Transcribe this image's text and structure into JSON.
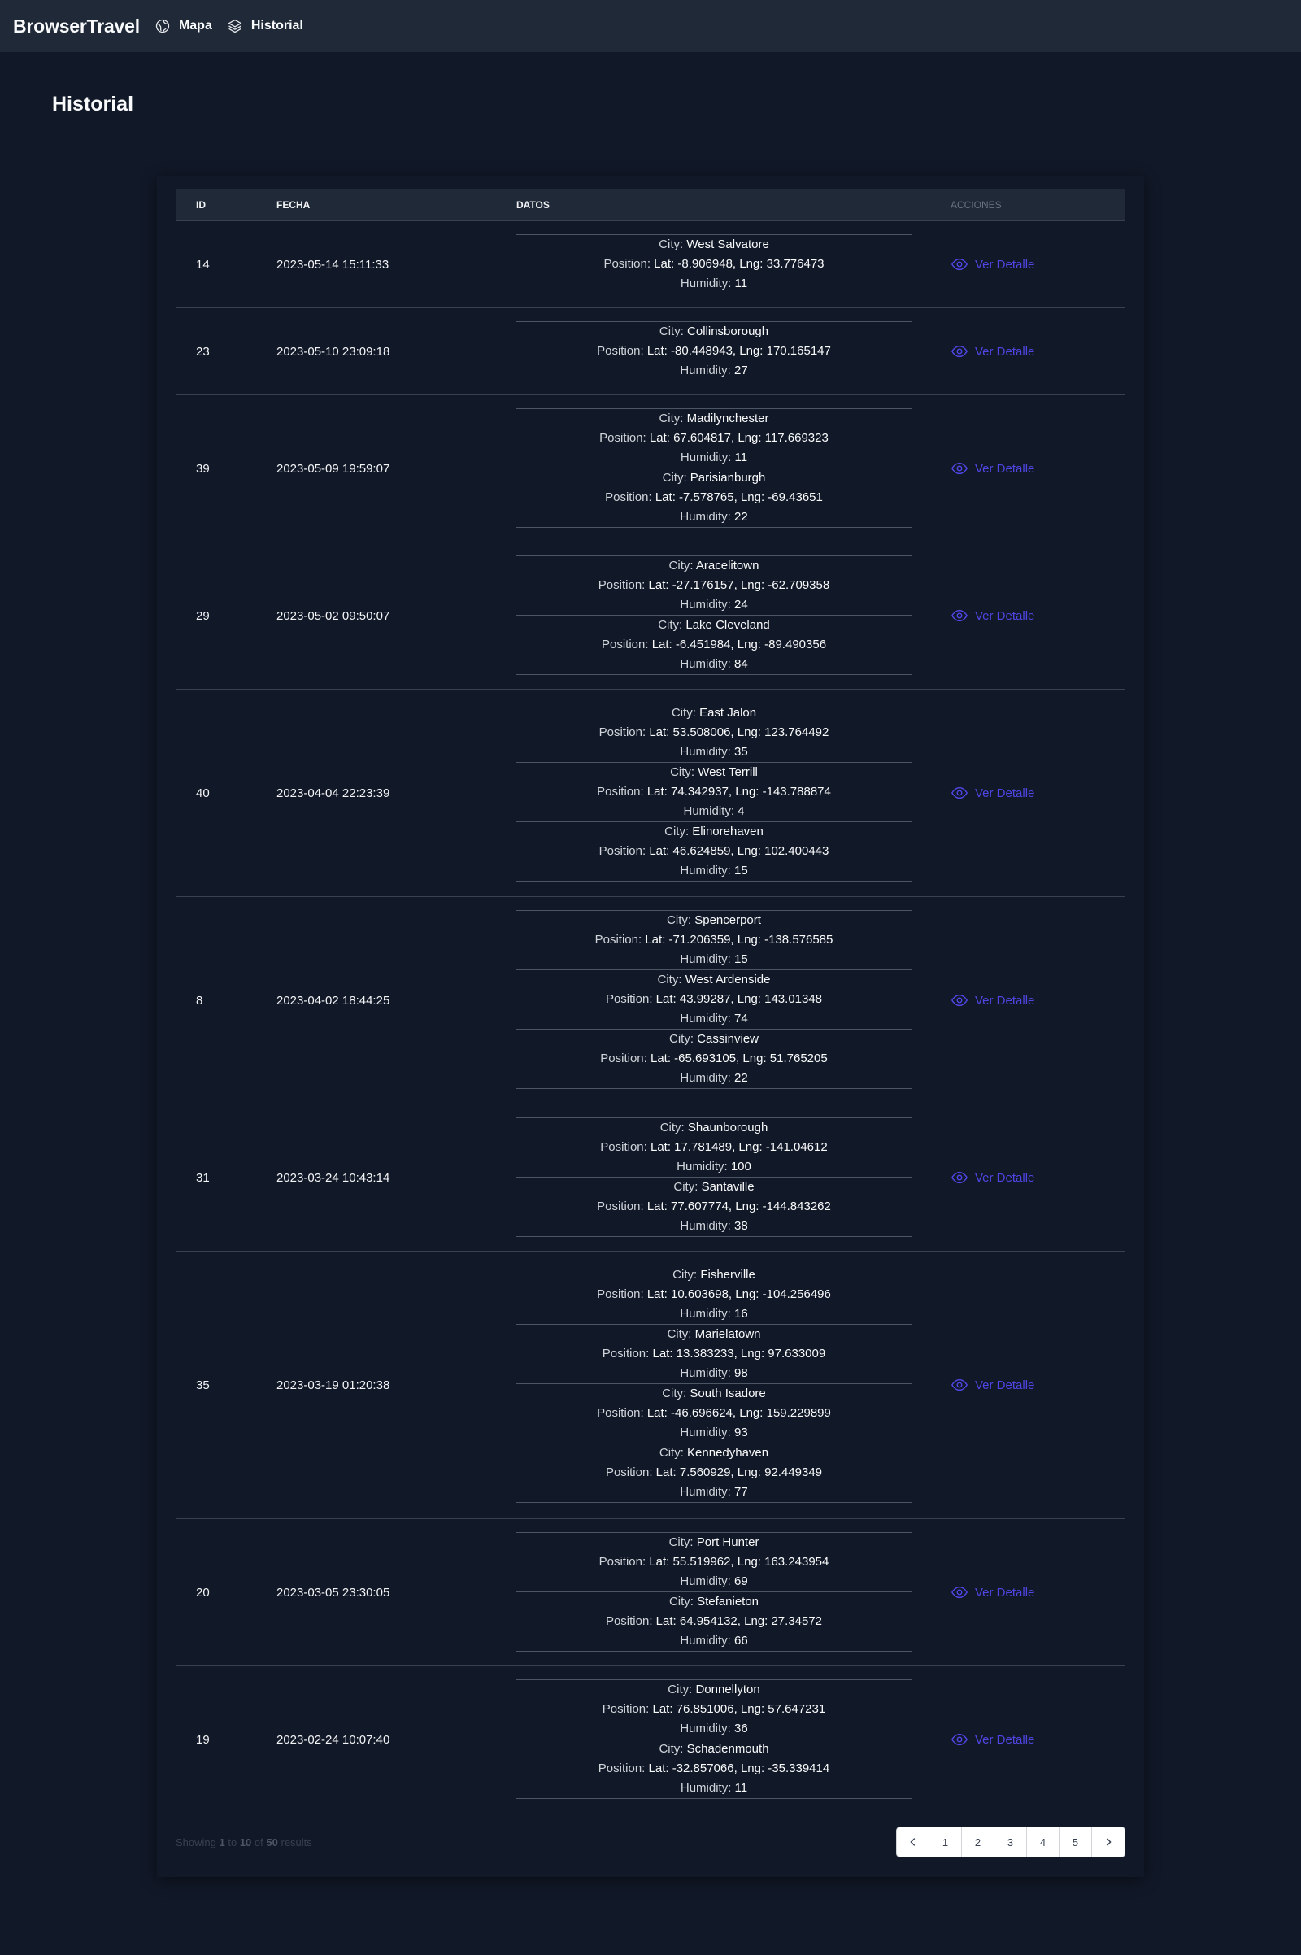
{
  "navbar": {
    "brand": "BrowserTravel",
    "links": [
      {
        "label": "Mapa",
        "icon": "globe-icon"
      },
      {
        "label": "Historial",
        "icon": "layers-icon"
      }
    ]
  },
  "page": {
    "title": "Historial"
  },
  "table": {
    "headers": {
      "id": "ID",
      "fecha": "FECHA",
      "datos": "DATOS",
      "acciones": "ACCIONES"
    },
    "labels": {
      "city": "City:",
      "position": "Position:",
      "humidity": "Humidity:",
      "action": "Ver Detalle"
    },
    "rows": [
      {
        "id": "14",
        "fecha": "2023-05-14 15:11:33",
        "entries": [
          {
            "city": "West Salvatore",
            "position": "Lat: -8.906948, Lng: 33.776473",
            "humidity": "11"
          }
        ]
      },
      {
        "id": "23",
        "fecha": "2023-05-10 23:09:18",
        "entries": [
          {
            "city": "Collinsborough",
            "position": "Lat: -80.448943, Lng: 170.165147",
            "humidity": "27"
          }
        ]
      },
      {
        "id": "39",
        "fecha": "2023-05-09 19:59:07",
        "entries": [
          {
            "city": "Madilynchester",
            "position": "Lat: 67.604817, Lng: 117.669323",
            "humidity": "11"
          },
          {
            "city": "Parisianburgh",
            "position": "Lat: -7.578765, Lng: -69.43651",
            "humidity": "22"
          }
        ]
      },
      {
        "id": "29",
        "fecha": "2023-05-02 09:50:07",
        "entries": [
          {
            "city": "Aracelitown",
            "position": "Lat: -27.176157, Lng: -62.709358",
            "humidity": "24"
          },
          {
            "city": "Lake Cleveland",
            "position": "Lat: -6.451984, Lng: -89.490356",
            "humidity": "84"
          }
        ]
      },
      {
        "id": "40",
        "fecha": "2023-04-04 22:23:39",
        "entries": [
          {
            "city": "East Jalon",
            "position": "Lat: 53.508006, Lng: 123.764492",
            "humidity": "35"
          },
          {
            "city": "West Terrill",
            "position": "Lat: 74.342937, Lng: -143.788874",
            "humidity": "4"
          },
          {
            "city": "Elinorehaven",
            "position": "Lat: 46.624859, Lng: 102.400443",
            "humidity": "15"
          }
        ]
      },
      {
        "id": "8",
        "fecha": "2023-04-02 18:44:25",
        "entries": [
          {
            "city": "Spencerport",
            "position": "Lat: -71.206359, Lng: -138.576585",
            "humidity": "15"
          },
          {
            "city": "West Ardenside",
            "position": "Lat: 43.99287, Lng: 143.01348",
            "humidity": "74"
          },
          {
            "city": "Cassinview",
            "position": "Lat: -65.693105, Lng: 51.765205",
            "humidity": "22"
          }
        ]
      },
      {
        "id": "31",
        "fecha": "2023-03-24 10:43:14",
        "entries": [
          {
            "city": "Shaunborough",
            "position": "Lat: 17.781489, Lng: -141.04612",
            "humidity": "100"
          },
          {
            "city": "Santaville",
            "position": "Lat: 77.607774, Lng: -144.843262",
            "humidity": "38"
          }
        ]
      },
      {
        "id": "35",
        "fecha": "2023-03-19 01:20:38",
        "entries": [
          {
            "city": "Fisherville",
            "position": "Lat: 10.603698, Lng: -104.256496",
            "humidity": "16"
          },
          {
            "city": "Marielatown",
            "position": "Lat: 13.383233, Lng: 97.633009",
            "humidity": "98"
          },
          {
            "city": "South Isadore",
            "position": "Lat: -46.696624, Lng: 159.229899",
            "humidity": "93"
          },
          {
            "city": "Kennedyhaven",
            "position": "Lat: 7.560929, Lng: 92.449349",
            "humidity": "77"
          }
        ]
      },
      {
        "id": "20",
        "fecha": "2023-03-05 23:30:05",
        "entries": [
          {
            "city": "Port Hunter",
            "position": "Lat: 55.519962, Lng: 163.243954",
            "humidity": "69"
          },
          {
            "city": "Stefanieton",
            "position": "Lat: 64.954132, Lng: 27.34572",
            "humidity": "66"
          }
        ]
      },
      {
        "id": "19",
        "fecha": "2023-02-24 10:07:40",
        "entries": [
          {
            "city": "Donnellyton",
            "position": "Lat: 76.851006, Lng: 57.647231",
            "humidity": "36"
          },
          {
            "city": "Schadenmouth",
            "position": "Lat: -32.857066, Lng: -35.339414",
            "humidity": "11"
          }
        ]
      }
    ]
  },
  "footer": {
    "showing_prefix": "Showing",
    "from": "1",
    "to_word": "to",
    "to": "10",
    "of_word": "of",
    "total": "50",
    "results_word": "results",
    "pages": [
      "1",
      "2",
      "3",
      "4",
      "5"
    ]
  },
  "colors": {
    "background": "#111827",
    "navbar": "#1f2937",
    "accent": "#4f46e5"
  }
}
